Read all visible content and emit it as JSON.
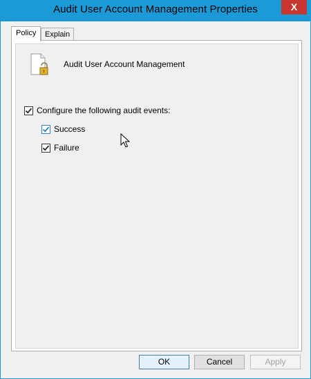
{
  "window": {
    "title": "Audit User Account Management Properties",
    "close_label": "X"
  },
  "tabs": [
    {
      "label": "Policy",
      "active": true
    },
    {
      "label": "Explain",
      "active": false
    }
  ],
  "policy": {
    "name": "Audit User Account Management",
    "icon": "policy-document-lock-icon"
  },
  "options": {
    "configure": {
      "label": "Configure the following audit events:",
      "checked": true
    },
    "success": {
      "label": "Success",
      "checked": true
    },
    "failure": {
      "label": "Failure",
      "checked": true
    }
  },
  "buttons": {
    "ok": "OK",
    "cancel": "Cancel",
    "apply": "Apply"
  },
  "colors": {
    "titlebar": "#1b9ad7",
    "close": "#c7372f"
  }
}
